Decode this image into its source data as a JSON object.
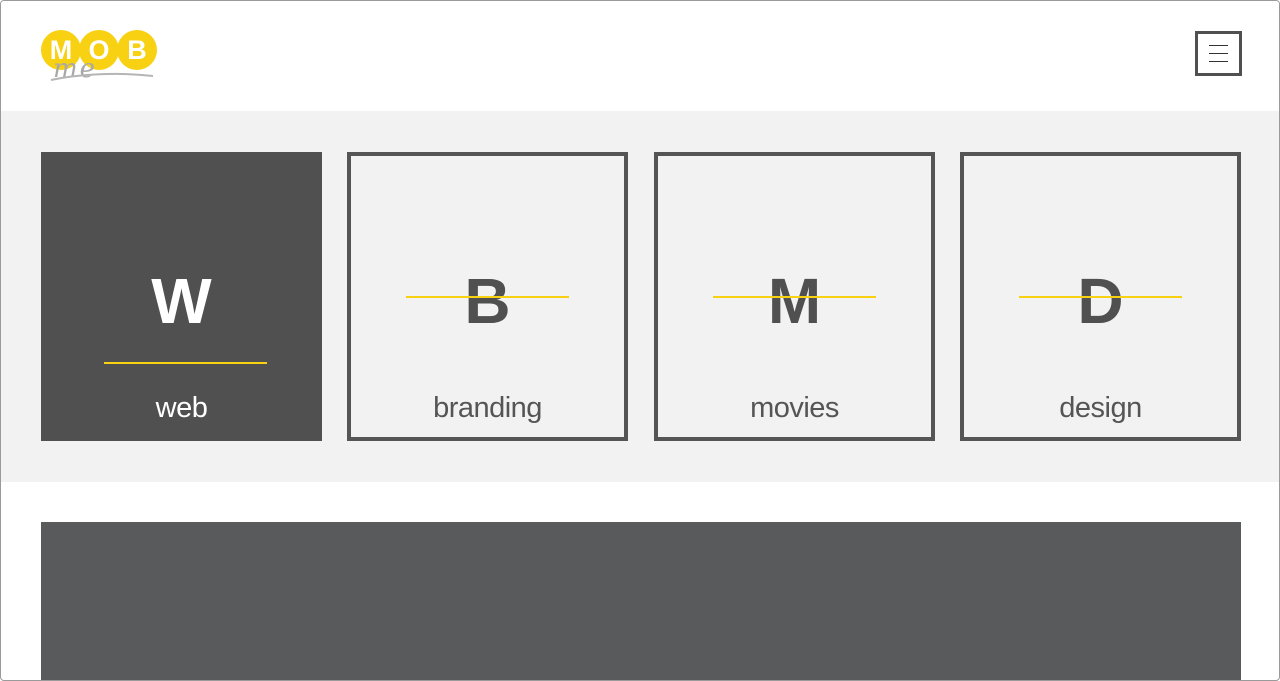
{
  "logo": {
    "letters": [
      "M",
      "O",
      "B"
    ],
    "tagline": "me"
  },
  "header": {
    "menu_icon": "hamburger-menu-icon"
  },
  "services": [
    {
      "letter": "W",
      "label": "web",
      "active": true
    },
    {
      "letter": "B",
      "label": "branding",
      "active": false
    },
    {
      "letter": "M",
      "label": "movies",
      "active": false
    },
    {
      "letter": "D",
      "label": "design",
      "active": false
    }
  ],
  "colors": {
    "accent": "#f7d112",
    "dark": "#505050",
    "section_bg": "#f2f2f2",
    "banner": "#595a5c"
  }
}
